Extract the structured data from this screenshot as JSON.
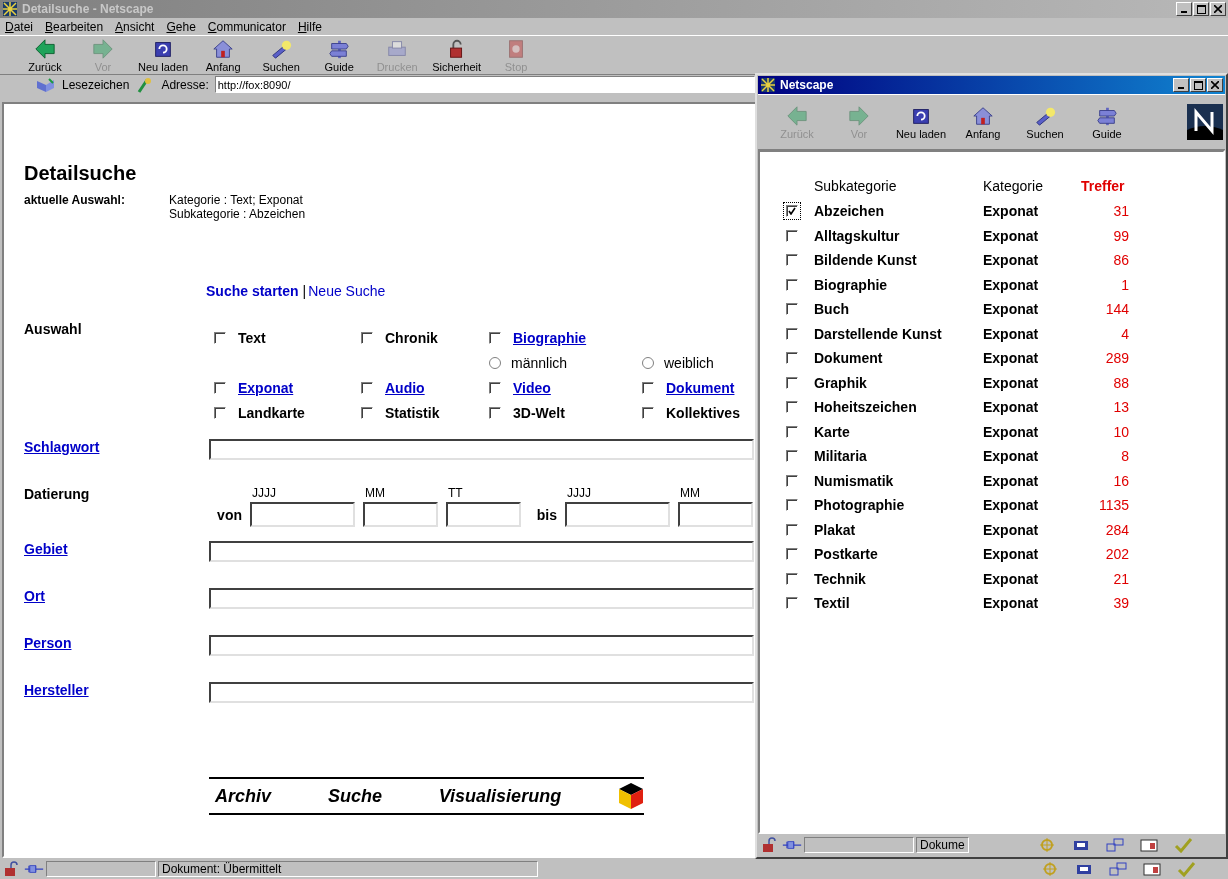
{
  "window": {
    "title": "Detailsuche - Netscape"
  },
  "menu": [
    "Datei",
    "Bearbeiten",
    "Ansicht",
    "Gehe",
    "Communicator",
    "Hilfe"
  ],
  "toolbar": [
    {
      "label": "Zurück",
      "disabled": false
    },
    {
      "label": "Vor",
      "disabled": true
    },
    {
      "label": "Neu laden",
      "disabled": false
    },
    {
      "label": "Anfang",
      "disabled": false
    },
    {
      "label": "Suchen",
      "disabled": false
    },
    {
      "label": "Guide",
      "disabled": false
    },
    {
      "label": "Drucken",
      "disabled": true
    },
    {
      "label": "Sicherheit",
      "disabled": false
    },
    {
      "label": "Stop",
      "disabled": true
    }
  ],
  "location": {
    "bookmarks": "Lesezeichen",
    "address_label": "Adresse:",
    "address": "http://fox:8090/"
  },
  "page": {
    "heading": "Detailsuche",
    "current_label": "aktuelle Auswahl:",
    "current_values": [
      "Kategorie : Text; Exponat",
      "Subkategorie : Abzeichen"
    ],
    "actions": [
      {
        "label": "Suche starten",
        "bold": true
      },
      {
        "label": "Neue Suche",
        "bold": false
      }
    ],
    "action_separator": "|",
    "auswahl": {
      "label": "Auswahl",
      "rows": [
        {
          "kind": "checks",
          "items": [
            {
              "label": "Text",
              "link": false,
              "checked": false
            },
            {
              "label": "Chronik",
              "link": false,
              "checked": false
            },
            {
              "label": "Biographie",
              "link": true,
              "checked": false
            }
          ]
        },
        {
          "kind": "radios",
          "items": [
            {
              "label": "männlich",
              "selected": false
            },
            {
              "label": "weiblich",
              "selected": false
            }
          ]
        },
        {
          "kind": "checks",
          "items": [
            {
              "label": "Exponat",
              "link": true,
              "checked": false
            },
            {
              "label": "Audio",
              "link": true,
              "checked": false
            },
            {
              "label": "Video",
              "link": true,
              "checked": false
            },
            {
              "label": "Dokument",
              "link": true,
              "checked": false
            }
          ]
        },
        {
          "kind": "checks",
          "items": [
            {
              "label": "Landkarte",
              "link": false,
              "checked": false
            },
            {
              "label": "Statistik",
              "link": false,
              "checked": false
            },
            {
              "label": "3D-Welt",
              "link": false,
              "checked": false
            },
            {
              "label": "Kollektives",
              "link": false,
              "checked": false
            }
          ]
        }
      ]
    },
    "fields": [
      {
        "kind": "text",
        "label": "Schlagwort",
        "link": true
      },
      {
        "kind": "date",
        "label": "Datierung",
        "link": false,
        "from_label": "von",
        "to_label": "bis",
        "columns": [
          "JJJJ",
          "MM",
          "TT",
          "JJJJ",
          "MM"
        ]
      },
      {
        "kind": "text",
        "label": "Gebiet",
        "link": true
      },
      {
        "kind": "text",
        "label": "Ort",
        "link": true
      },
      {
        "kind": "text",
        "label": "Person",
        "link": true
      },
      {
        "kind": "text",
        "label": "Hersteller",
        "link": true
      }
    ],
    "logo_bar": [
      "Archiv",
      "Suche",
      "Visualisierung"
    ]
  },
  "status_bar": {
    "text": "Dokument: Übermittelt"
  },
  "popup": {
    "title": "Netscape",
    "toolbar": [
      {
        "label": "Zurück",
        "disabled": true
      },
      {
        "label": "Vor",
        "disabled": true
      },
      {
        "label": "Neu laden",
        "disabled": false
      },
      {
        "label": "Anfang",
        "disabled": false
      },
      {
        "label": "Suchen",
        "disabled": false
      },
      {
        "label": "Guide",
        "disabled": false
      }
    ],
    "columns": [
      "Subkategorie",
      "Kategorie",
      "Treffer"
    ],
    "rows": [
      {
        "name": "Abzeichen",
        "category": "Exponat",
        "hits": "31",
        "checked": true
      },
      {
        "name": "Alltagskultur",
        "category": "Exponat",
        "hits": "99",
        "checked": false
      },
      {
        "name": "Bildende Kunst",
        "category": "Exponat",
        "hits": "86",
        "checked": false
      },
      {
        "name": "Biographie",
        "category": "Exponat",
        "hits": "1",
        "checked": false
      },
      {
        "name": "Buch",
        "category": "Exponat",
        "hits": "144",
        "checked": false
      },
      {
        "name": "Darstellende Kunst",
        "category": "Exponat",
        "hits": "4",
        "checked": false
      },
      {
        "name": "Dokument",
        "category": "Exponat",
        "hits": "289",
        "checked": false
      },
      {
        "name": "Graphik",
        "category": "Exponat",
        "hits": "88",
        "checked": false
      },
      {
        "name": "Hoheitszeichen",
        "category": "Exponat",
        "hits": "13",
        "checked": false
      },
      {
        "name": "Karte",
        "category": "Exponat",
        "hits": "10",
        "checked": false
      },
      {
        "name": "Militaria",
        "category": "Exponat",
        "hits": "8",
        "checked": false
      },
      {
        "name": "Numismatik",
        "category": "Exponat",
        "hits": "16",
        "checked": false
      },
      {
        "name": "Photographie",
        "category": "Exponat",
        "hits": "1135",
        "checked": false
      },
      {
        "name": "Plakat",
        "category": "Exponat",
        "hits": "284",
        "checked": false
      },
      {
        "name": "Postkarte",
        "category": "Exponat",
        "hits": "202",
        "checked": false
      },
      {
        "name": "Technik",
        "category": "Exponat",
        "hits": "21",
        "checked": false
      },
      {
        "name": "Textil",
        "category": "Exponat",
        "hits": "39",
        "checked": false
      }
    ],
    "status_text": "Dokume"
  }
}
